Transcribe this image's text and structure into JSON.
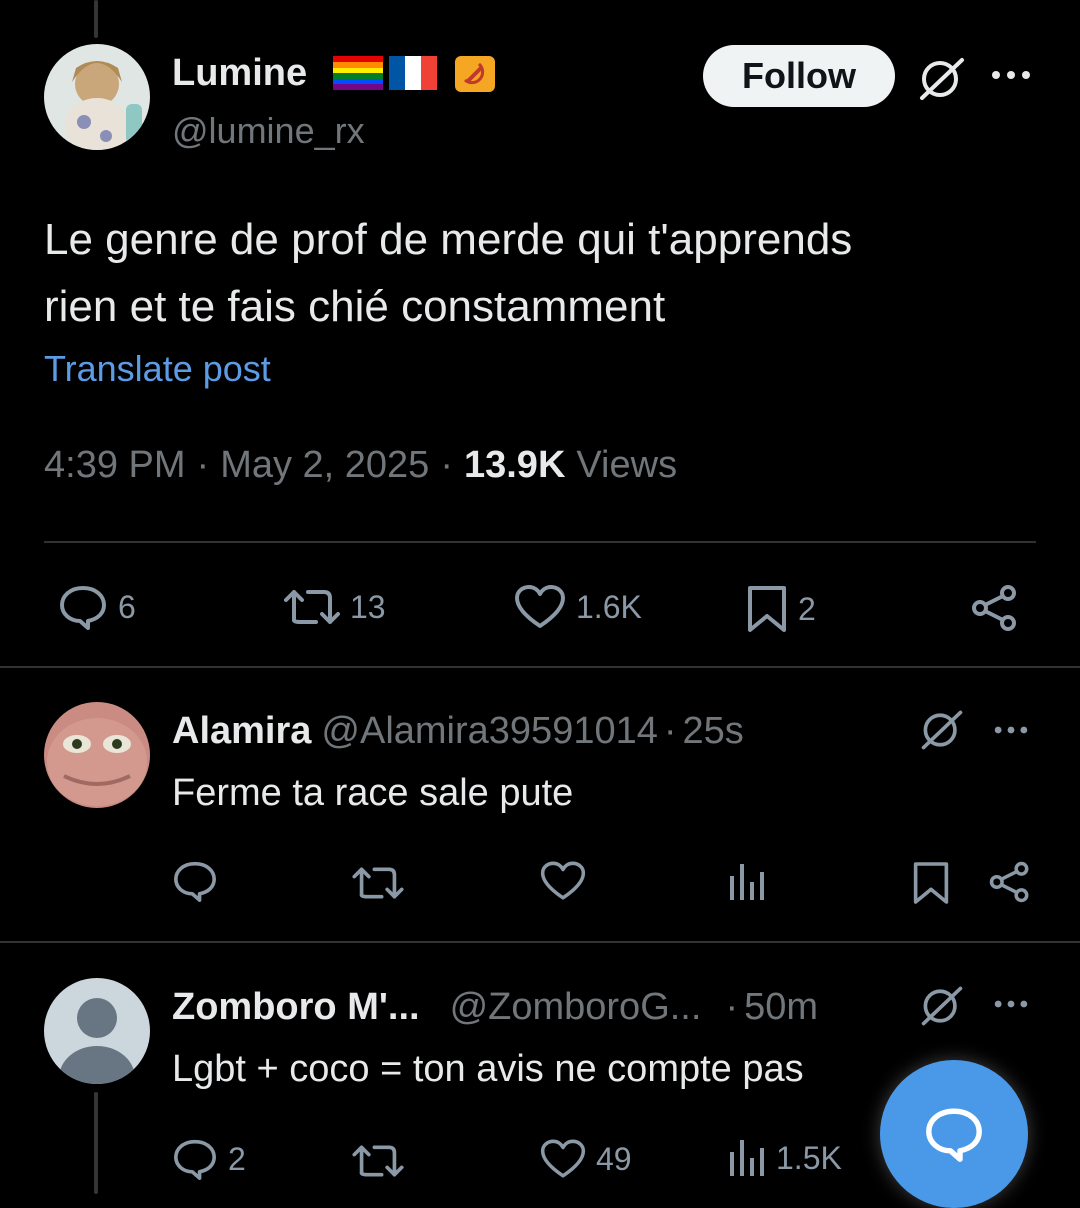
{
  "post": {
    "author_name": "Lumine",
    "author_handle": "@lumine_rx",
    "follow_label": "Follow",
    "text_line1": "Le genre de prof de merde qui t'apprends",
    "text_line2": "rien et te fais chié constamment",
    "translate_label": "Translate post",
    "time": "4:39 PM",
    "date": "May 2, 2025",
    "views_count": "13.9K",
    "views_label": "Views",
    "sep": "·",
    "stats": {
      "replies": "6",
      "reposts": "13",
      "likes": "1.6K",
      "bookmarks": "2"
    }
  },
  "replies": [
    {
      "name": "Alamira",
      "handle": "@Alamira39591014",
      "time": "25s",
      "text": "Ferme ta race sale pute"
    },
    {
      "name": "Zomboro M'...",
      "handle": "@ZomboroG...",
      "time": "50m",
      "text": "Lgbt + coco = ton avis ne compte pas",
      "stats": {
        "replies": "2",
        "likes": "49",
        "views": "1.5K"
      }
    }
  ],
  "colors": {
    "accent": "#4a99e9",
    "link": "#5c9ce6",
    "muted": "#71767b",
    "background": "#000000"
  }
}
